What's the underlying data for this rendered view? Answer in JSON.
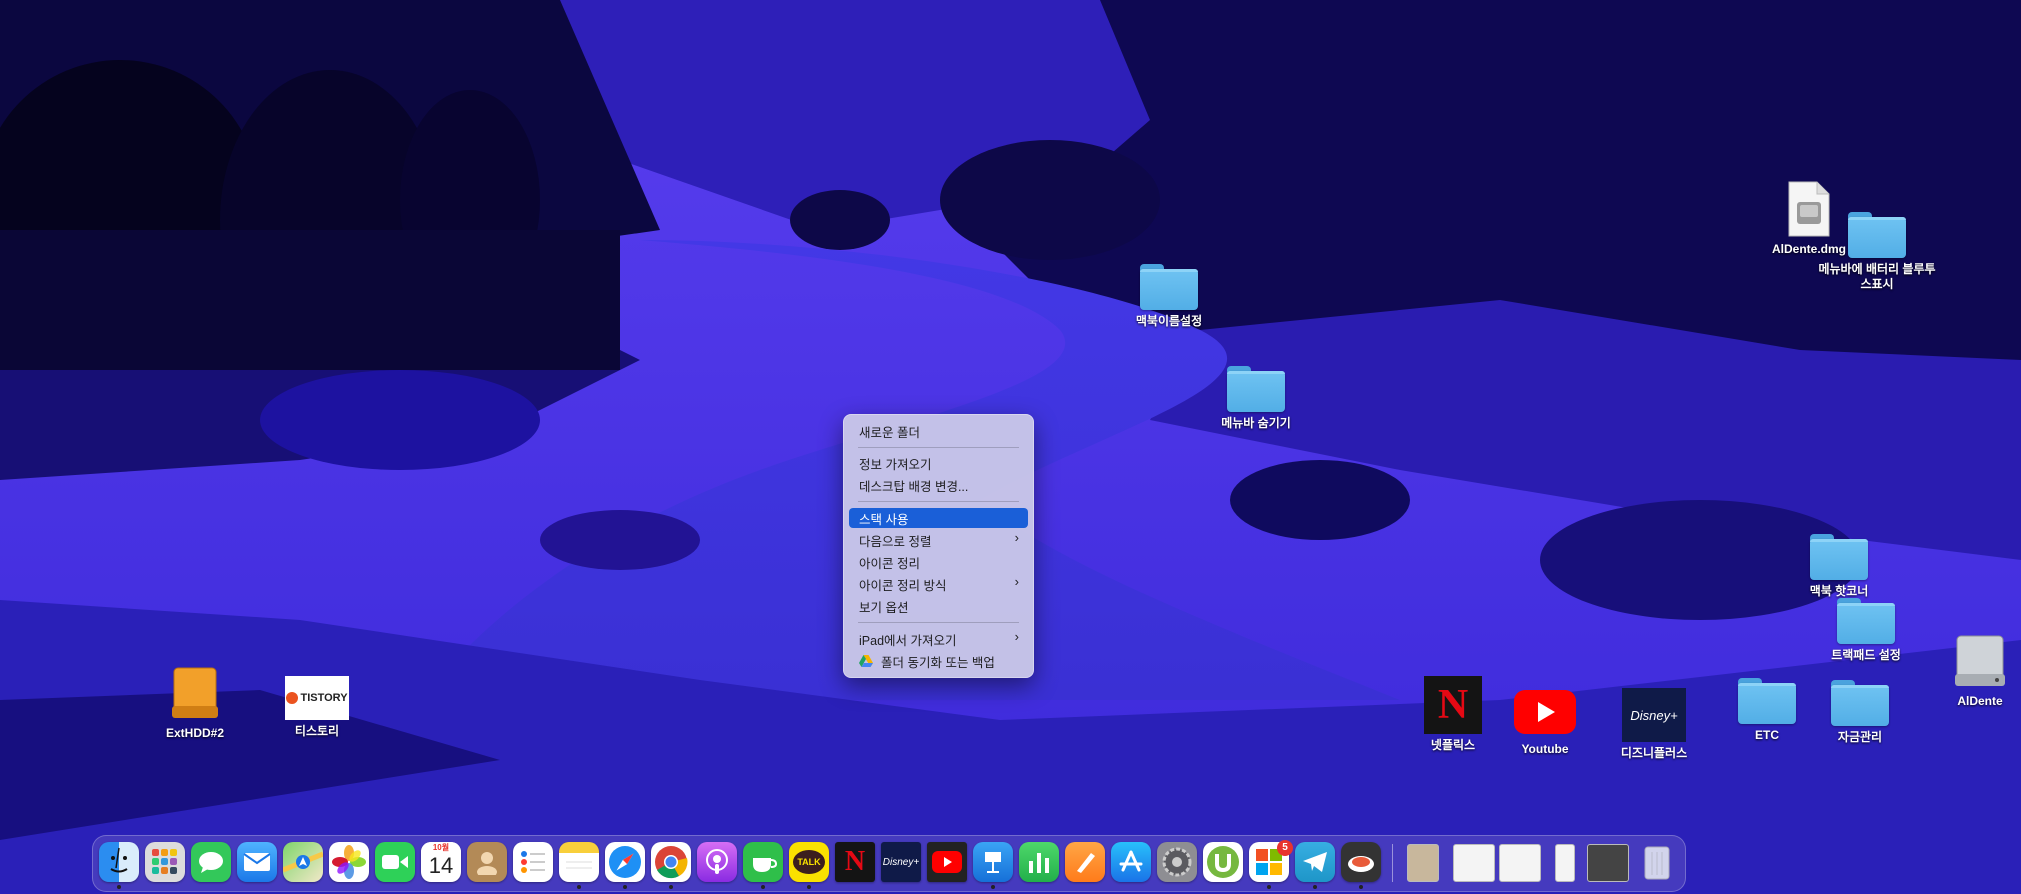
{
  "desktop": {
    "icons": [
      {
        "label": "AlDente.dmg"
      },
      {
        "label": "메뉴바에 배터리 블루투스표시"
      },
      {
        "label": "맥북이름설정"
      },
      {
        "label": "메뉴바 숨기기"
      },
      {
        "label": "맥북 핫코너"
      },
      {
        "label": "트랙패드 설정"
      },
      {
        "label": "AlDente"
      },
      {
        "label": "넷플릭스"
      },
      {
        "label": "Youtube"
      },
      {
        "label": "디즈니플러스"
      },
      {
        "label": "ETC"
      },
      {
        "label": "자금관리"
      },
      {
        "label": "ExtHDD#2"
      },
      {
        "label": "티스토리"
      }
    ],
    "tistory_logo_text": "TISTORY",
    "disney_logo_text": "Disney+"
  },
  "context_menu": {
    "items": [
      {
        "label": "새로운 폴더"
      },
      {
        "label": "정보 가져오기"
      },
      {
        "label": "데스크탑 배경 변경..."
      },
      {
        "label": "스택 사용",
        "highlighted": true
      },
      {
        "label": "다음으로 정렬",
        "submenu": true
      },
      {
        "label": "아이콘 정리"
      },
      {
        "label": "아이콘 정리 방식",
        "submenu": true
      },
      {
        "label": "보기 옵션"
      },
      {
        "label": "iPad에서 가져오기",
        "submenu": true
      },
      {
        "label": "폴더 동기화 또는 백업",
        "icon": "google-drive-icon"
      }
    ],
    "submenu_arrow": "›"
  },
  "dock": {
    "calendar": {
      "month": "10월",
      "day": "14"
    },
    "kakao_label": "TALK",
    "netflix_label": "N",
    "disney_label": "Disney+",
    "badge_count": "5",
    "apps": [
      "finder-icon",
      "launchpad-icon",
      "messages-icon",
      "mail-icon",
      "maps-icon",
      "photos-icon",
      "facetime-icon",
      "calendar-icon",
      "contacts-icon",
      "reminders-icon",
      "notes-icon",
      "safari-icon",
      "chrome-icon",
      "podcasts-icon",
      "kakaotalk-icon",
      "kakaotalk-talk-icon",
      "netflix-icon",
      "disney-plus-icon",
      "youtube-icon",
      "keynote-icon",
      "numbers-icon",
      "pages-icon",
      "app-store-icon",
      "system-preferences-icon",
      "utorrent-icon",
      "office-icon",
      "telegram-icon",
      "gyroflow-icon",
      "trash-icon"
    ]
  },
  "colors": {
    "accent": "#1a5fd8",
    "folder": "#5ab4ea",
    "wallpaper": "#2c1fc4"
  }
}
